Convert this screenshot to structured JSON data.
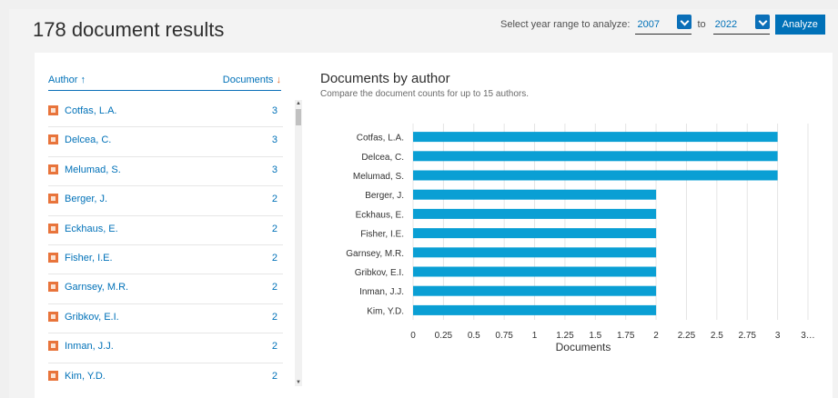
{
  "header": {
    "results_title": "178 document results",
    "year_range_label": "Select year range to analyze:",
    "year_from": "2007",
    "to_label": "to",
    "year_to": "2022",
    "analyze_label": "Analyze"
  },
  "table": {
    "author_header": "Author",
    "author_sort_icon": "arrow-up",
    "documents_header": "Documents",
    "documents_sort_icon": "arrow-down",
    "rows": [
      {
        "name": "Cotfas, L.A.",
        "count": "3"
      },
      {
        "name": "Delcea, C.",
        "count": "3"
      },
      {
        "name": "Melumad, S.",
        "count": "3"
      },
      {
        "name": "Berger, J.",
        "count": "2"
      },
      {
        "name": "Eckhaus, E.",
        "count": "2"
      },
      {
        "name": "Fisher, I.E.",
        "count": "2"
      },
      {
        "name": "Garnsey, M.R.",
        "count": "2"
      },
      {
        "name": "Gribkov, E.I.",
        "count": "2"
      },
      {
        "name": "Inman, J.J.",
        "count": "2"
      },
      {
        "name": "Kim, Y.D.",
        "count": "2"
      }
    ]
  },
  "chart_panel": {
    "title": "Documents by author",
    "subtitle": "Compare the document counts for up to 15 authors."
  },
  "colors": {
    "accent": "#0071b8",
    "bar": "#0a9fd4",
    "checkbox": "#e8743b"
  },
  "chart_data": {
    "type": "bar",
    "orientation": "horizontal",
    "categories": [
      "Cotfas, L.A.",
      "Delcea, C.",
      "Melumad, S.",
      "Berger, J.",
      "Eckhaus, E.",
      "Fisher, I.E.",
      "Garnsey, M.R.",
      "Gribkov, E.I.",
      "Inman, J.J.",
      "Kim, Y.D."
    ],
    "values": [
      3,
      3,
      3,
      2,
      2,
      2,
      2,
      2,
      2,
      2
    ],
    "xlabel": "Documents",
    "ylabel": "",
    "xlim": [
      0,
      3.25
    ],
    "ticks": [
      "0",
      "0.25",
      "0.5",
      "0.75",
      "1",
      "1.25",
      "1.5",
      "1.75",
      "2",
      "2.25",
      "2.5",
      "2.75",
      "3",
      "3…"
    ],
    "grid": true
  }
}
